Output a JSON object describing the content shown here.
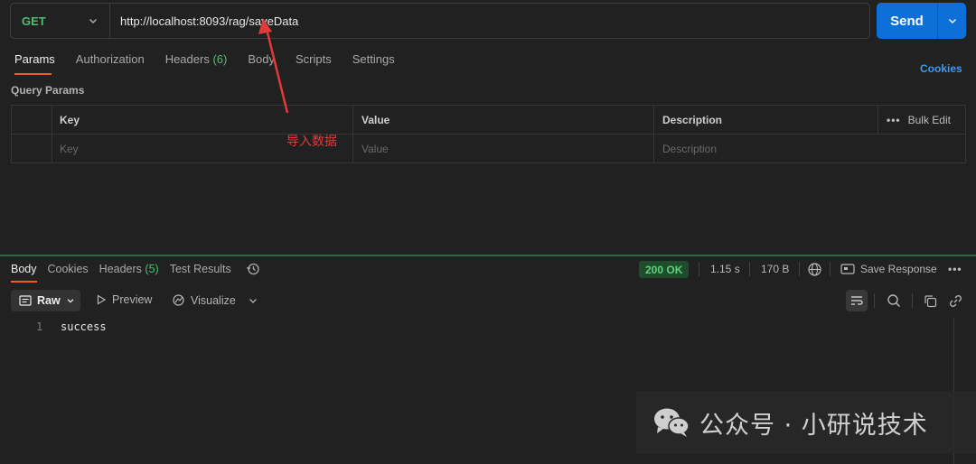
{
  "request": {
    "method": "GET",
    "url": "http://localhost:8093/rag/saveData",
    "send_label": "Send"
  },
  "request_tabs": [
    {
      "label": "Params",
      "count": ""
    },
    {
      "label": "Authorization",
      "count": ""
    },
    {
      "label": "Headers",
      "count": "(6)"
    },
    {
      "label": "Body",
      "count": ""
    },
    {
      "label": "Scripts",
      "count": ""
    },
    {
      "label": "Settings",
      "count": ""
    }
  ],
  "cookies_link": "Cookies",
  "query_params": {
    "title": "Query Params",
    "headers": {
      "key": "Key",
      "value": "Value",
      "description": "Description",
      "bulk_edit": "Bulk Edit"
    },
    "placeholders": {
      "key": "Key",
      "value": "Value",
      "description": "Description"
    }
  },
  "annotation": {
    "text": "导入数据",
    "color": "#e23a3a"
  },
  "response": {
    "tabs": [
      {
        "label": "Body",
        "count": ""
      },
      {
        "label": "Cookies",
        "count": ""
      },
      {
        "label": "Headers",
        "count": "(5)"
      },
      {
        "label": "Test Results",
        "count": ""
      }
    ],
    "status": "200 OK",
    "time": "1.15 s",
    "size": "170 B",
    "save_label": "Save Response",
    "format": "Raw",
    "preview_label": "Preview",
    "visualize_label": "Visualize",
    "lines": [
      {
        "no": "1",
        "text": "success"
      }
    ]
  },
  "watermark": {
    "text": "公众号 · 小研说技术"
  },
  "colors": {
    "accent": "#ef5b25",
    "send": "#0d6fd8",
    "method": "#4cbf6e",
    "link": "#3b9af5"
  }
}
